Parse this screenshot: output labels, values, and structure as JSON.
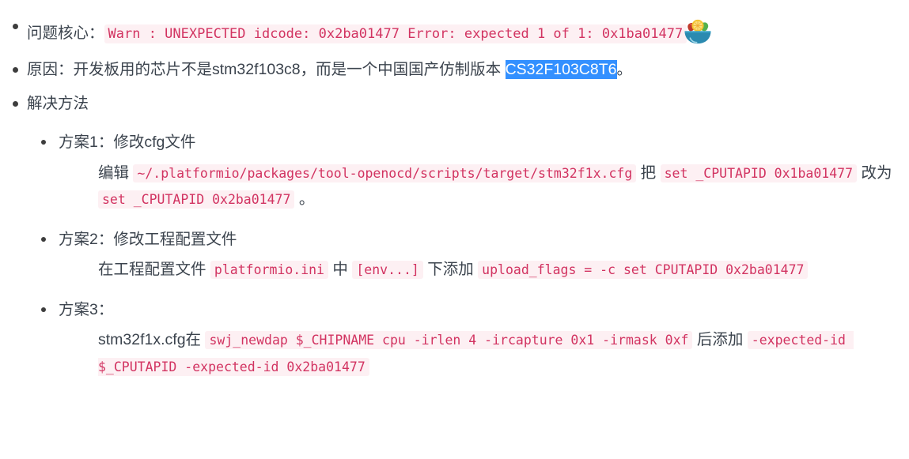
{
  "document": {
    "theme": {
      "background": "#ffffff",
      "text_color": "#3b434d",
      "code_text_color": "#d23361",
      "code_background": "#fdf0f3",
      "selection_background": "#3390ff",
      "selection_text": "#ffffff",
      "bullet_color": "#3d3d3d"
    },
    "items": [
      {
        "label_zh": "问题核心：",
        "code": "Warn : UNEXPECTED idcode: 0x2ba01477 Error: expected 1 of 1: 0x1ba01477",
        "emoji_name": "salad-bowl-emoji",
        "emoji_char": "🥗"
      },
      {
        "text_before": "原因：开发板用的芯片不是stm32f103c8，而是一个中国国产仿制版本 ",
        "selected_text": "CS32F103C8T6",
        "text_after": "。"
      },
      {
        "label_zh": "解决方法",
        "subitems": [
          {
            "head": "方案1：修改cfg文件",
            "body": {
              "t1": "编辑 ",
              "c1": "~/.platformio/packages/tool-openocd/scripts/target/stm32f1x.cfg",
              "t2": " 把 ",
              "c2": "set _CPUTAPID 0x1ba01477",
              "t3": " 改为 ",
              "c3": "set _CPUTAPID 0x2ba01477",
              "t4": " 。"
            }
          },
          {
            "head": "方案2：修改工程配置文件",
            "body": {
              "t1": "在工程配置文件 ",
              "c1": "platformio.ini",
              "t2": " 中 ",
              "c2": "[env...]",
              "t3": " 下添加 ",
              "c3": "upload_flags = -c set CPUTAPID 0x2ba01477",
              "t4": ""
            }
          },
          {
            "head": "方案3：",
            "body": {
              "t1": "stm32f1x.cfg在 ",
              "c1": "swj_newdap $_CHIPNAME cpu -irlen 4 -ircapture 0x1 -irmask 0xf",
              "t2": " 后添加 ",
              "c2": "-expected-id $_CPUTAPID -expected-id 0x2ba01477",
              "t3": "",
              "c3": "",
              "t4": ""
            }
          }
        ]
      }
    ]
  }
}
